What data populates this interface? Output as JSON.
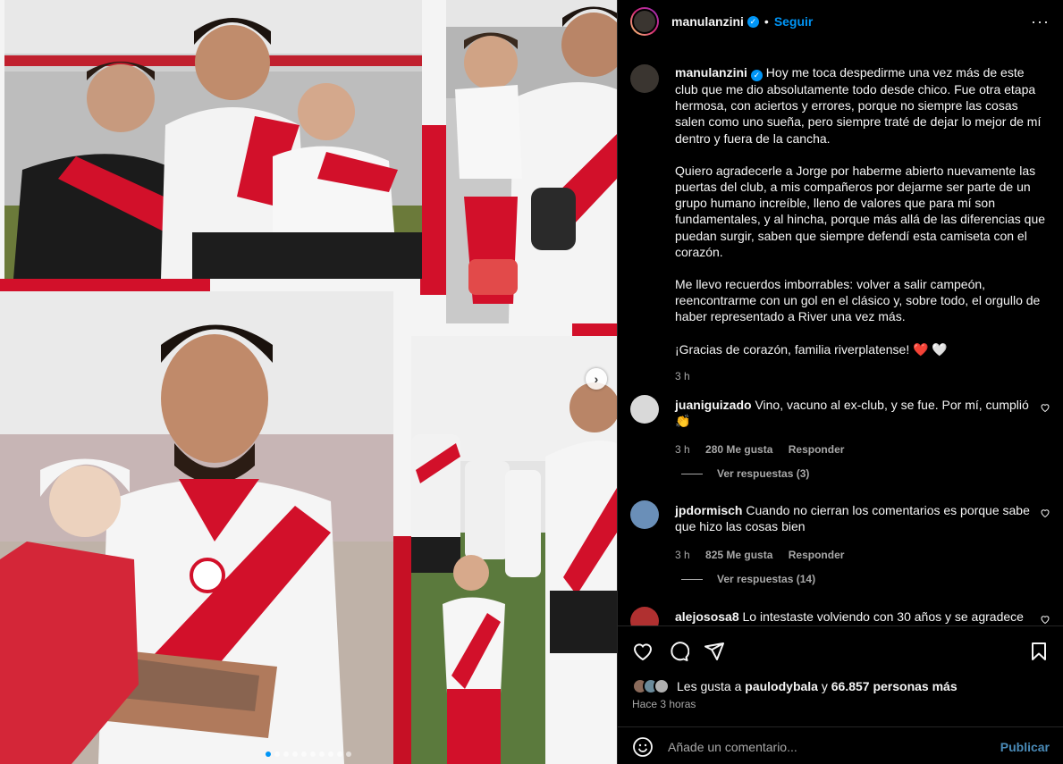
{
  "post": {
    "username": "manulanzini",
    "follow_label": "Seguir",
    "more_label": "···",
    "caption_paragraphs": [
      "Hoy me toca despedirme una vez más de este club que me dio absolutamente todo desde chico. Fue otra etapa hermosa, con aciertos y errores, porque no siempre las cosas salen como uno sueña, pero siempre traté de dejar lo mejor de mí dentro y fuera de la cancha.",
      "Quiero agradecerle a Jorge por haberme abierto nuevamente las puertas del club, a mis compañeros por dejarme ser parte de un grupo humano increíble, lleno de valores que para mí son fundamentales, y al hincha, porque más allá de las diferencias que puedan surgir, saben que siempre defendí esta camiseta con el corazón.",
      "Me llevo recuerdos imborrables: volver a salir campeón, reencontrarme con un gol en el clásico y, sobre todo, el orgullo de haber representado a River una vez más.",
      "¡Gracias de corazón, familia riverplatense! ❤️ 🤍"
    ],
    "caption_time": "3 h"
  },
  "comments": [
    {
      "username": "juaniguizado",
      "text": "Vino, vacuno al ex-club, y se fue. Por mí, cumplió 👏",
      "time": "3 h",
      "likes": "280 Me gusta",
      "reply": "Responder",
      "view_replies": "Ver respuestas (3)"
    },
    {
      "username": "jpdormisch",
      "text": "Cuando no cierran los comentarios es porque sabe que hizo las cosas bien",
      "time": "3 h",
      "likes": "825 Me gusta",
      "reply": "Responder",
      "view_replies": "Ver respuestas (14)"
    },
    {
      "username": "alejososa8",
      "text": "Lo intestaste volviendo con 30 años y se agradece"
    }
  ],
  "likes": {
    "prefix": "Les gusta a",
    "user": "paulodybala",
    "conj": "y",
    "others": "66.857 personas más"
  },
  "posted_ago": "Hace 3 horas",
  "comment_box": {
    "placeholder": "Añade un comentario...",
    "publish_label": "Publicar"
  },
  "carousel": {
    "slide_count": 10,
    "active_index": 0
  },
  "colors": {
    "river_red": "#d2102a",
    "link_blue": "#0095f6",
    "panel_bg": "#000000",
    "muted_text": "#a8a8a8"
  }
}
